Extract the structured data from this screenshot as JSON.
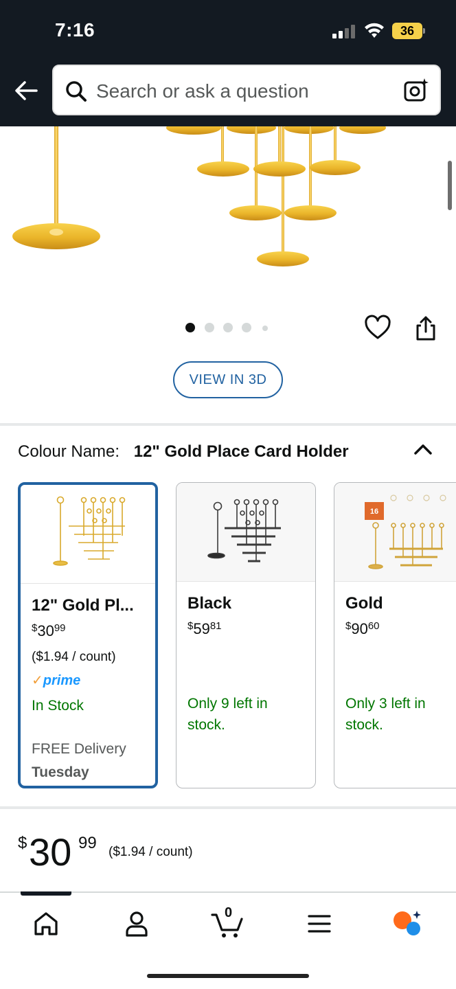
{
  "status_bar": {
    "time": "7:16",
    "battery": "36"
  },
  "search": {
    "placeholder": "Search or ask a question"
  },
  "gallery": {
    "dots": 5,
    "active_dot": 0
  },
  "view_3d": {
    "label": "VIEW IN 3D"
  },
  "variation": {
    "label": "Colour Name:",
    "selected_value": "12\" Gold Place Card Holder",
    "options": [
      {
        "title": "12\" Gold Pl...",
        "price_currency": "$",
        "price_whole": "30",
        "price_fraction": "99",
        "unit_price": "($1.94 / count)",
        "prime": "prime",
        "stock": "In Stock",
        "delivery_label": "FREE Delivery",
        "delivery_day": "Tuesday",
        "selected": true
      },
      {
        "title": "Black",
        "price_currency": "$",
        "price_whole": "59",
        "price_fraction": "81",
        "stock": "Only 9 left in stock.",
        "selected": false
      },
      {
        "title": "Gold",
        "price_currency": "$",
        "price_whole": "90",
        "price_fraction": "60",
        "stock": "Only 3 left in stock.",
        "badge": "16",
        "selected": false
      }
    ]
  },
  "price": {
    "currency": "$",
    "whole": "30",
    "fraction": "99",
    "unit": "($1.94 / count)"
  },
  "bottom_nav": {
    "items": [
      "home-icon",
      "account-icon",
      "cart-icon",
      "menu-icon",
      "rufus-ai-icon"
    ],
    "cart_count": "0"
  },
  "colors": {
    "header_bg": "#131a22",
    "link_blue": "#2162a1",
    "stock_green": "#007600",
    "prime_blue": "#1a98ff",
    "gold": "#e9b824"
  }
}
